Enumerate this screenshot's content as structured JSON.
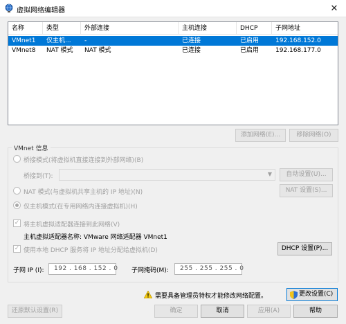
{
  "window": {
    "title": "虚拟网络编辑器",
    "close_glyph": "✕"
  },
  "table": {
    "columns": [
      "名称",
      "类型",
      "外部连接",
      "主机连接",
      "DHCP",
      "子网地址"
    ],
    "rows": [
      {
        "name": "VMnet1",
        "type": "仅主机...",
        "external": "-",
        "host": "已连接",
        "dhcp": "已启用",
        "subnet": "192.168.152.0",
        "selected": true
      },
      {
        "name": "VMnet8",
        "type": "NAT 模式",
        "external": "NAT 模式",
        "host": "已连接",
        "dhcp": "已启用",
        "subnet": "192.168.177.0",
        "selected": false
      }
    ]
  },
  "buttons": {
    "add_network": "添加网络(E)...",
    "remove_network": "移除网络(O)",
    "auto_settings": "自动设置(U)...",
    "nat_settings": "NAT 设置(S)...",
    "dhcp_settings": "DHCP 设置(P)...",
    "change_settings": "更改设置(C)",
    "restore_defaults": "还原默认设置(R)",
    "ok": "确定",
    "cancel": "取消",
    "apply": "应用(A)",
    "help": "帮助"
  },
  "vmnet_info": {
    "legend": "VMnet 信息",
    "bridged_label": "桥接模式(将虚拟机直接连接到外部网络)(B)",
    "bridged_to_label": "桥接到(T):",
    "nat_label": "NAT 模式(与虚拟机共享主机的 IP 地址)(N)",
    "hostonly_label": "仅主机模式(在专用网络内连接虚拟机)(H)",
    "connect_adapter_label": "将主机虚拟适配器连接到此网络(V)",
    "adapter_name_label": "主机虚拟适配器名称: VMware 网络适配器 VMnet1",
    "dhcp_label": "使用本地 DHCP 服务将 IP 地址分配给虚拟机(D)",
    "subnet_ip_label": "子网 IP (I):",
    "subnet_ip_value": "192 . 168 . 152 .  0",
    "subnet_mask_label": "子网掩码(M):",
    "subnet_mask_value": "255 . 255 . 255 .  0",
    "selected_mode": "hostonly"
  },
  "admin_notice": "需要具备管理员特权才能修改网络配置。",
  "colors": {
    "selection": "#0078d7",
    "warning": "#f2c811"
  }
}
